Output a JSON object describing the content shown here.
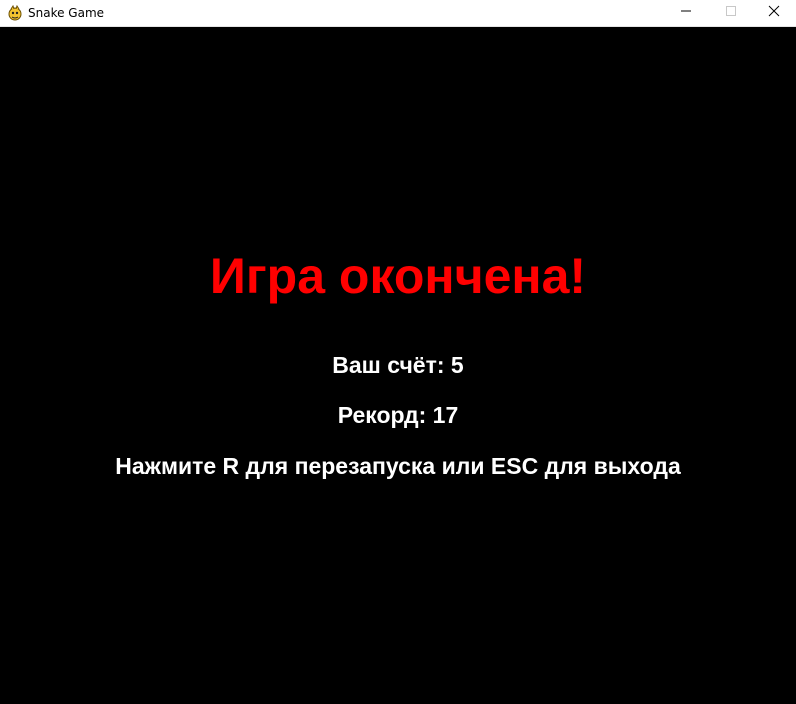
{
  "window": {
    "title": "Snake Game",
    "icon": "pygame-snake-icon"
  },
  "game_over": {
    "title": "Игра окончена!",
    "title_color": "#ff0000",
    "score_line": "Ваш счёт: 5",
    "record_line": "Рекорд: 17",
    "hint_line": "Нажмите R для перезапуска или ESC для выхода",
    "text_color": "#ffffff",
    "background": "#000000"
  }
}
